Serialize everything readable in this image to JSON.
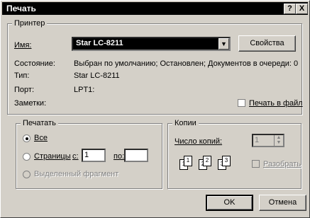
{
  "window": {
    "title": "Печать",
    "help_label": "?",
    "close_label": "X"
  },
  "printer": {
    "group_label": "Принтер",
    "name_label": "Имя:",
    "name_value": "Star LC-8211",
    "properties_button": "Свойства",
    "status_label": "Состояние:",
    "status_value": "Выбран по умолчанию; Остановлен; Документов в очереди: 0",
    "type_label": "Тип:",
    "type_value": "Star LC-8211",
    "port_label": "Порт:",
    "port_value": "LPT1:",
    "notes_label": "Заметки:",
    "print_to_file_label": "Печать в файл",
    "print_to_file_checked": false
  },
  "print_range": {
    "group_label": "Печатать",
    "all_label": "Все",
    "pages_label": "Страницы",
    "from_label": "с:",
    "from_value": "1",
    "to_label": "по:",
    "to_value": "",
    "selection_label": "Выделенный фрагмент",
    "selected": "all"
  },
  "copies": {
    "group_label": "Копии",
    "count_label": "Число копий:",
    "count_value": "1",
    "collate_label": "Разобрать",
    "pages": [
      "1",
      "1",
      "2",
      "2",
      "3",
      "3"
    ]
  },
  "buttons": {
    "ok": "OK",
    "cancel": "Отмена"
  }
}
